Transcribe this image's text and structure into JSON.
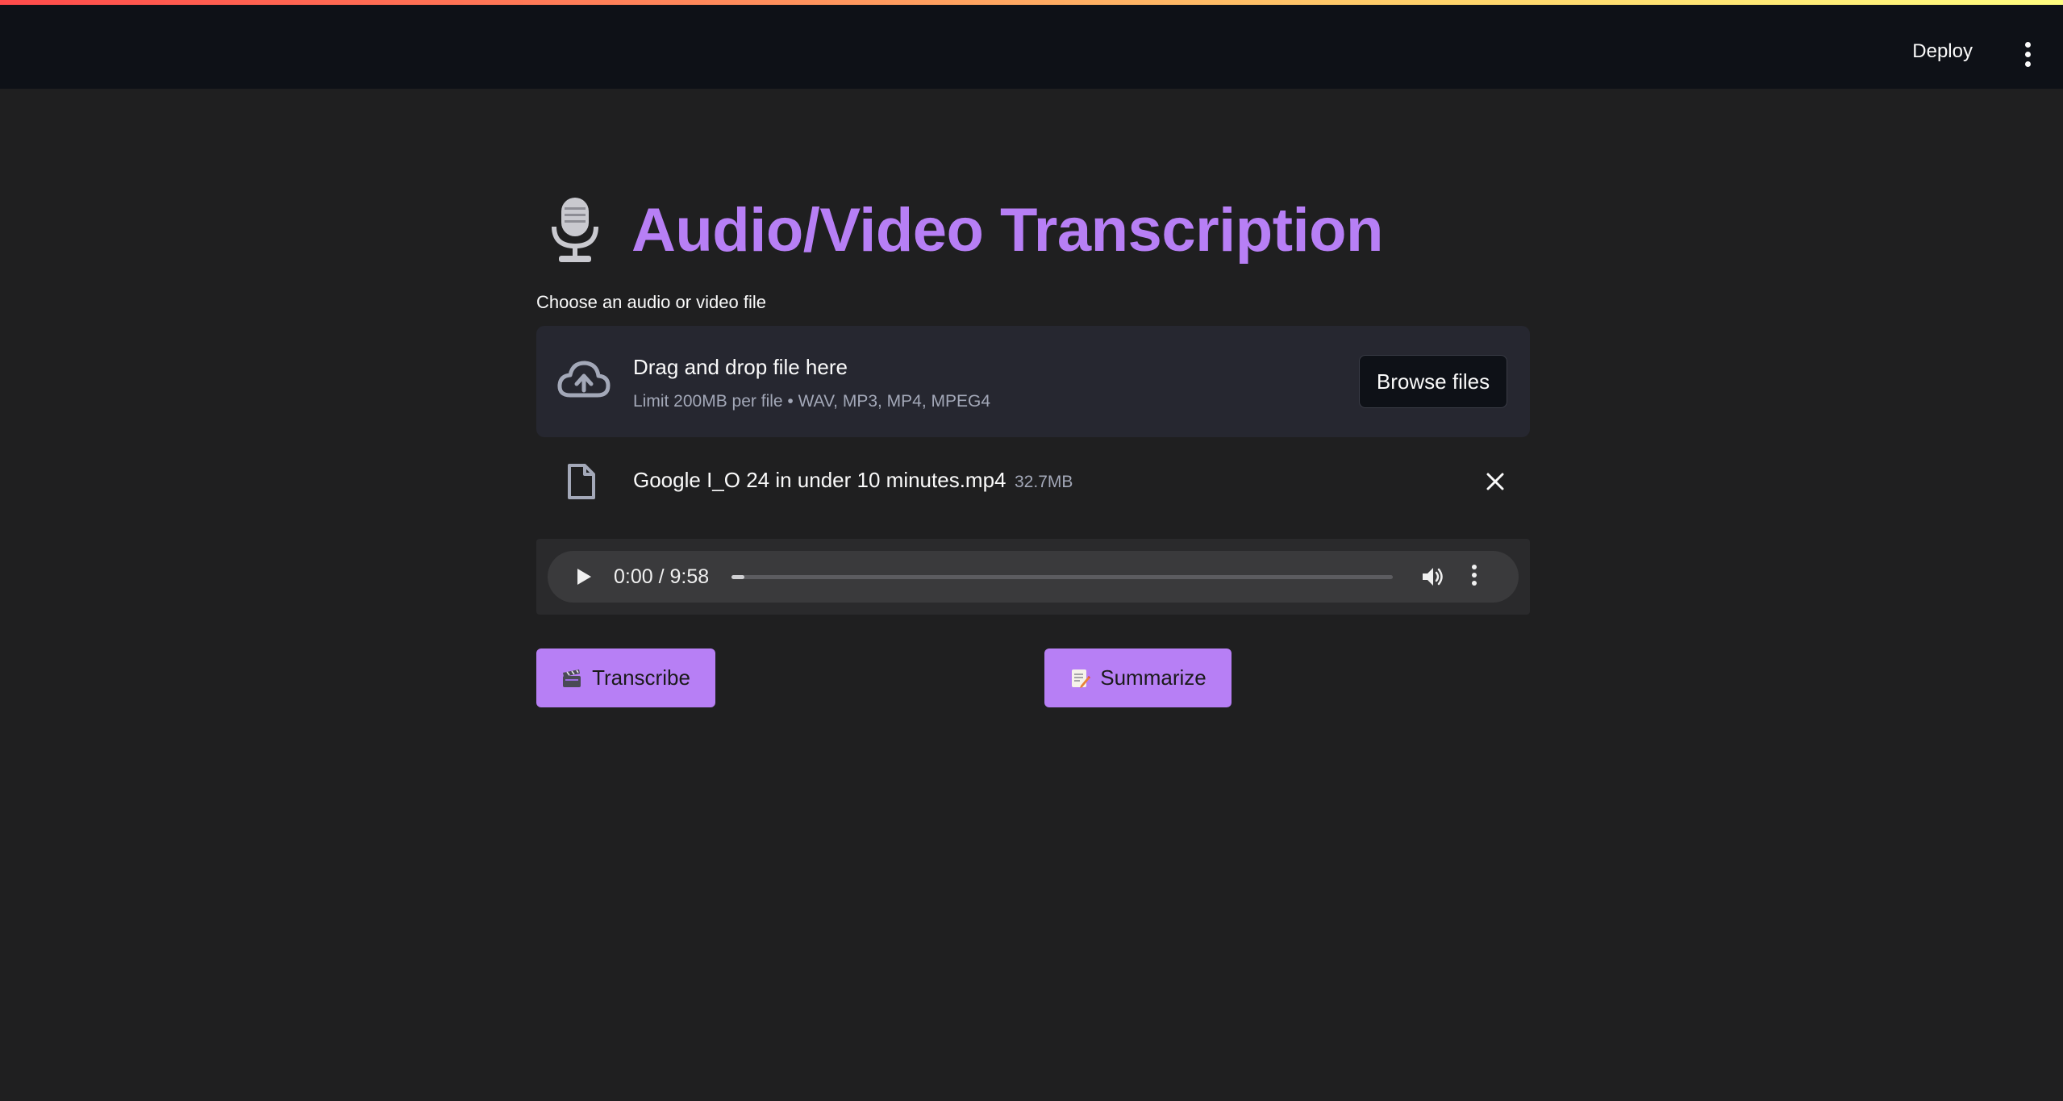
{
  "header": {
    "deploy_label": "Deploy",
    "menu_icon": "kebab-menu-icon"
  },
  "page": {
    "title": "Audio/Video Transcription",
    "title_icon": "microphone-icon",
    "accent_color": "#b77ff5"
  },
  "uploader": {
    "label": "Choose an audio or video file",
    "drop_title": "Drag and drop file here",
    "drop_subtitle": "Limit 200MB per file • WAV, MP3, MP4, MPEG4",
    "browse_label": "Browse files",
    "icon": "cloud-upload-icon"
  },
  "uploaded_file": {
    "name": "Google I_O 24 in under 10 minutes.mp4",
    "size": "32.7MB",
    "icon": "file-icon"
  },
  "player": {
    "time": "0:00 / 9:58",
    "progress_fraction": 0.02
  },
  "actions": {
    "transcribe_label": "Transcribe",
    "transcribe_icon": "clapperboard-icon",
    "summarize_label": "Summarize",
    "summarize_icon": "memo-icon"
  }
}
